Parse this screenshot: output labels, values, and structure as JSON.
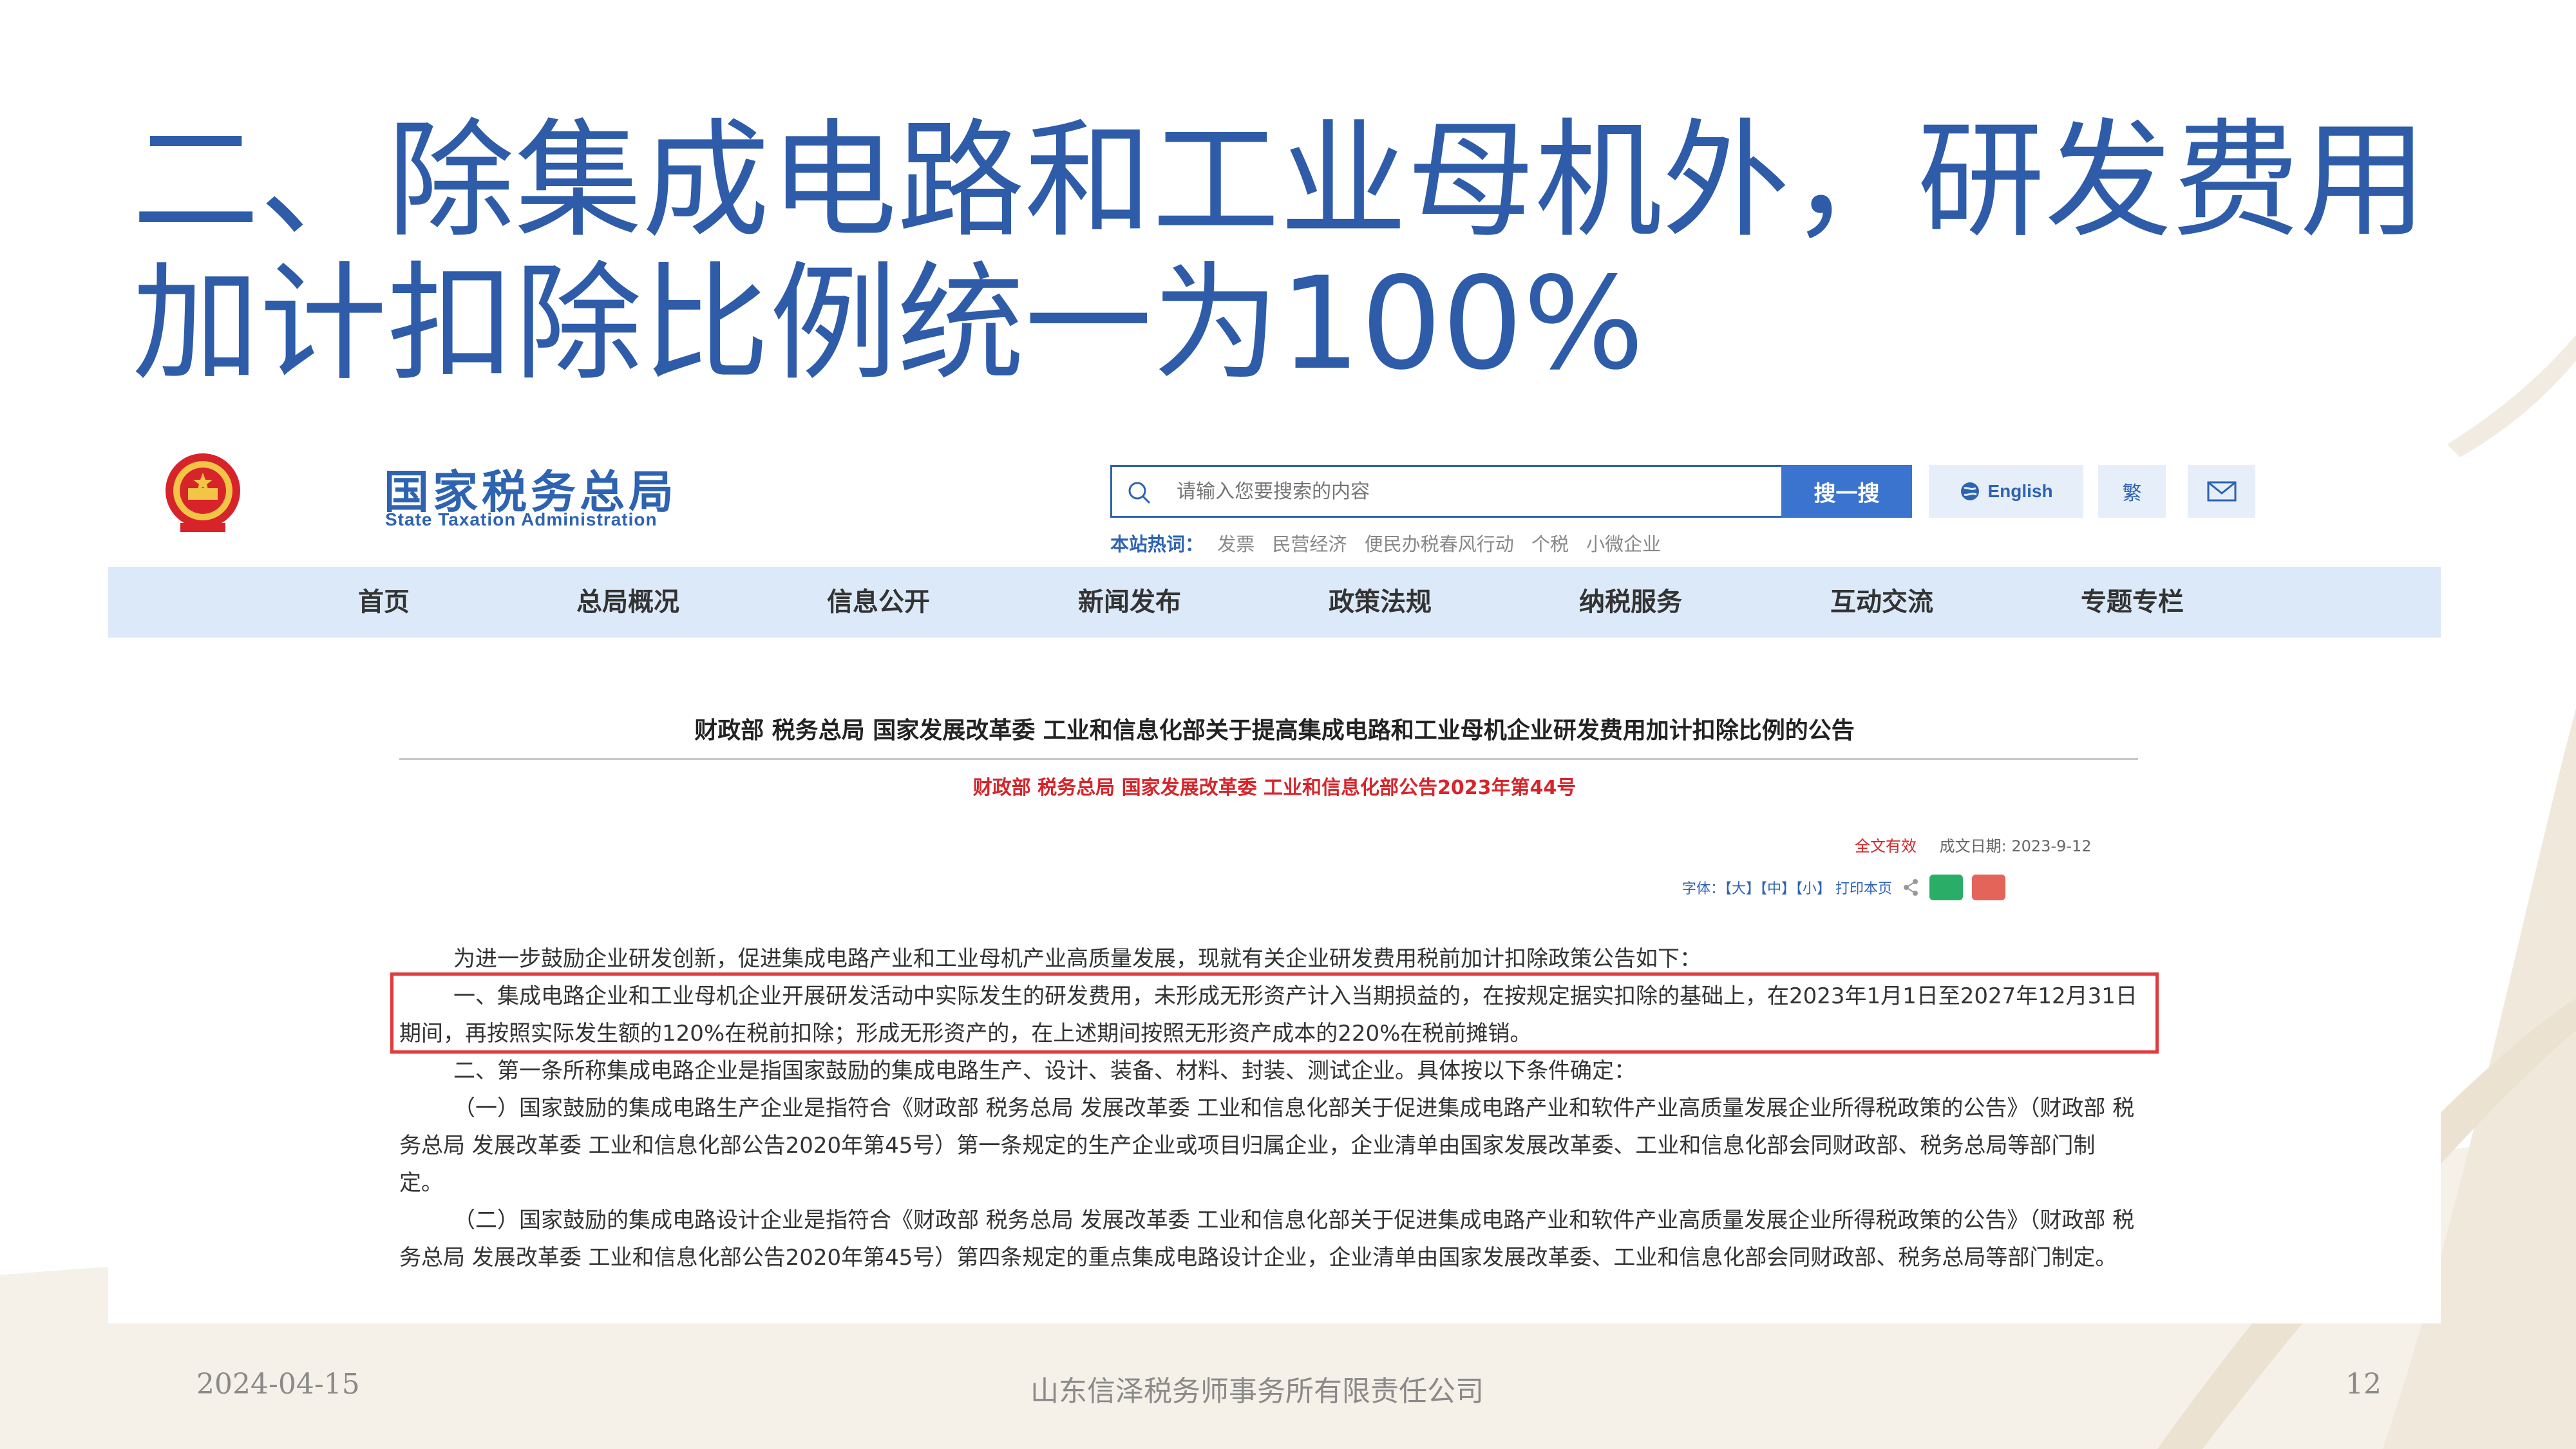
{
  "slide": {
    "title_line1": "二、除集成电路和工业母机外，研发费用",
    "title_line2": "加计扣除比例统一为100%",
    "footer_date": "2024-04-15",
    "footer_company": "山东信泽税务师事务所有限责任公司",
    "page_number": "12",
    "title_color": "#2f5ca8"
  },
  "site": {
    "name_cn": "国家税务总局",
    "name_en": "State Taxation Administration",
    "emblem_icon": "national-emblem-icon",
    "search_placeholder": "请输入您要搜索的内容",
    "search_button": "搜一搜",
    "lang_button": "English",
    "trad_button": "繁",
    "mail_icon": "mail-icon",
    "hot_label": "本站热词：",
    "hot_words": [
      "发票",
      "民营经济",
      "便民办税春风行动",
      "个税",
      "小微企业"
    ],
    "accent_color": "#2d63b1"
  },
  "nav": [
    "首页",
    "总局概况",
    "信息公开",
    "新闻发布",
    "政策法规",
    "纳税服务",
    "互动交流",
    "专题专栏"
  ],
  "document": {
    "title": "财政部 税务总局 国家发展改革委 工业和信息化部关于提高集成电路和工业母机企业研发费用加计扣除比例的公告",
    "subtitle": "财政部 税务总局 国家发展改革委 工业和信息化部公告2023年第44号",
    "validity": "全文有效",
    "date_label": "成文日期:",
    "date": "2023-9-12",
    "tools": "字体：【大】【中】【小】  打印本页",
    "paragraphs": [
      "为进一步鼓励企业研发创新，促进集成电路产业和工业母机产业高质量发展，现就有关企业研发费用税前加计扣除政策公告如下：",
      "一、集成电路企业和工业母机企业开展研发活动中实际发生的研发费用，未形成无形资产计入当期损益的，在按规定据实扣除的基础上，在2023年1月1日至2027年12月31日期间，再按照实际发生额的120%在税前扣除；形成无形资产的，在上述期间按照无形资产成本的220%在税前摊销。",
      "二、第一条所称集成电路企业是指国家鼓励的集成电路生产、设计、装备、材料、封装、测试企业。具体按以下条件确定：",
      "（一）国家鼓励的集成电路生产企业是指符合《财政部 税务总局 发展改革委 工业和信息化部关于促进集成电路产业和软件产业高质量发展企业所得税政策的公告》（财政部 税务总局 发展改革委 工业和信息化部公告2020年第45号）第一条规定的生产企业或项目归属企业，企业清单由国家发展改革委、工业和信息化部会同财政部、税务总局等部门制定。",
      "（二）国家鼓励的集成电路设计企业是指符合《财政部 税务总局 发展改革委 工业和信息化部关于促进集成电路产业和软件产业高质量发展企业所得税政策的公告》（财政部 税务总局 发展改革委 工业和信息化部公告2020年第45号）第四条规定的重点集成电路设计企业，企业清单由国家发展改革委、工业和信息化部会同财政部、税务总局等部门制定。"
    ],
    "highlight_color": "#e13b3e"
  }
}
